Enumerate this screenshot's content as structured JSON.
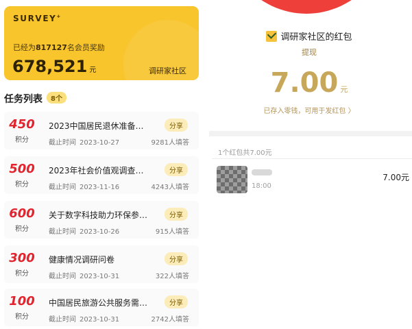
{
  "survey_panel": {
    "brand": "SURVEY",
    "brand_mark": "+",
    "subtitle_prefix": "已经为",
    "member_count": "817127",
    "subtitle_suffix": "名会员奖励",
    "total_amount": "678,521",
    "total_unit": "元",
    "community_label": "调研家社区",
    "task_header": "任务列表",
    "task_count_badge": "8个",
    "tasks": [
      {
        "points": "450",
        "points_label": "积分",
        "title": "2023中国居民退休准备…",
        "share_label": "分享",
        "deadline_label": "截止时间",
        "deadline": "2023-10-27",
        "responses": "9281人填答"
      },
      {
        "points": "500",
        "points_label": "积分",
        "title": "2023年社会价值观调查…",
        "share_label": "分享",
        "deadline_label": "截止时间",
        "deadline": "2023-11-16",
        "responses": "4243人填答"
      },
      {
        "points": "600",
        "points_label": "积分",
        "title": "关于数字科技助力环保参…",
        "share_label": "分享",
        "deadline_label": "截止时间",
        "deadline": "2023-10-26",
        "responses": "915人填答"
      },
      {
        "points": "300",
        "points_label": "积分",
        "title": "健康情况调研问卷",
        "share_label": "分享",
        "deadline_label": "截止时间",
        "deadline": "2023-10-31",
        "responses": "322人填答"
      },
      {
        "points": "100",
        "points_label": "积分",
        "title": "中国居民旅游公共服务需…",
        "share_label": "分享",
        "deadline_label": "截止时间",
        "deadline": "2023-10-31",
        "responses": "2742人填答"
      }
    ]
  },
  "red_packet_panel": {
    "title": "调研家社区的红包",
    "withdraw_label": "提现",
    "amount": "7.00",
    "amount_unit": "元",
    "deposited_note": "已存入零钱，可用于发红包 〉",
    "summary": "1个红包共7.00元",
    "records": [
      {
        "time": "18:00",
        "amount": "7.00元"
      }
    ]
  },
  "colors": {
    "card_yellow": "#f9c52d",
    "points_red": "#e2242f",
    "packet_gold": "#c7a85a",
    "packet_red": "#ef3f3b"
  }
}
